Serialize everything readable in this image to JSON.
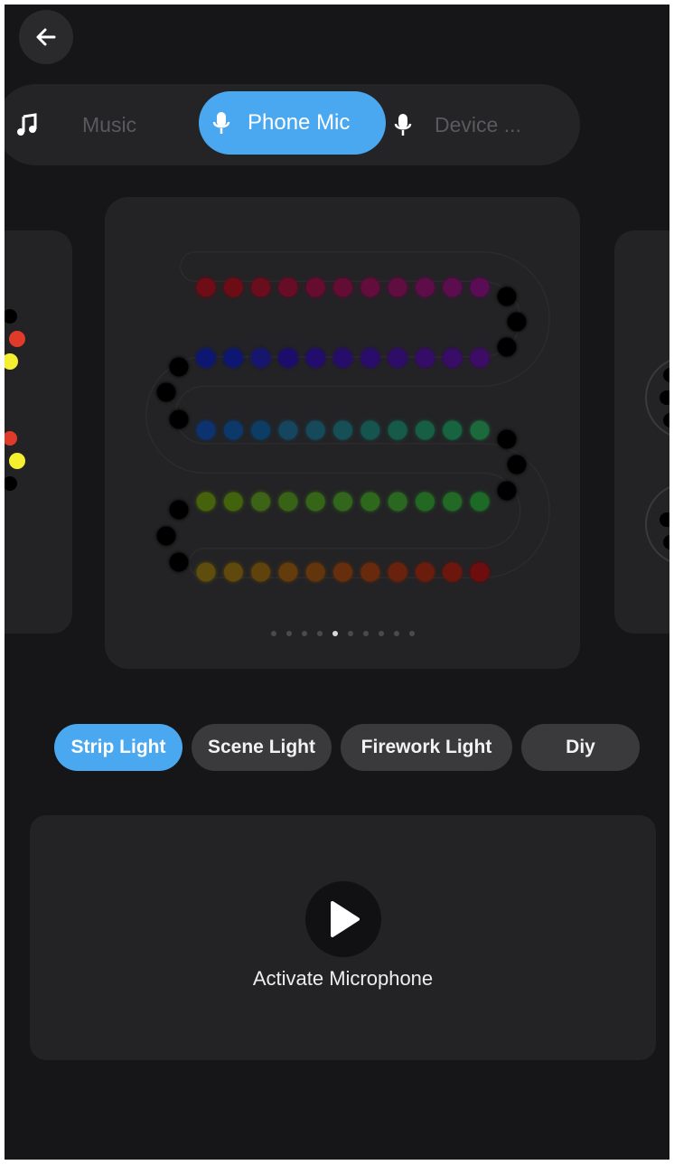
{
  "nav": {
    "back_icon": "arrow-left-icon"
  },
  "sources": [
    {
      "label": "Music",
      "icon": "music-note-icon",
      "active": false
    },
    {
      "label": "Phone Mic",
      "icon": "microphone-icon",
      "active": true
    },
    {
      "label": "Device ...",
      "icon": "microphone-icon",
      "active": false
    }
  ],
  "carousel": {
    "pages": 10,
    "current_page": 5
  },
  "light_tabs": [
    {
      "label": "Strip Light",
      "active": true
    },
    {
      "label": "Scene Light",
      "active": false
    },
    {
      "label": "Firework Light",
      "active": false
    },
    {
      "label": "Diy",
      "active": false
    }
  ],
  "activate": {
    "label": "Activate Microphone",
    "icon": "play-icon"
  },
  "colors": {
    "accent": "#4aa8f0",
    "background": "#161618",
    "card": "#232325"
  }
}
